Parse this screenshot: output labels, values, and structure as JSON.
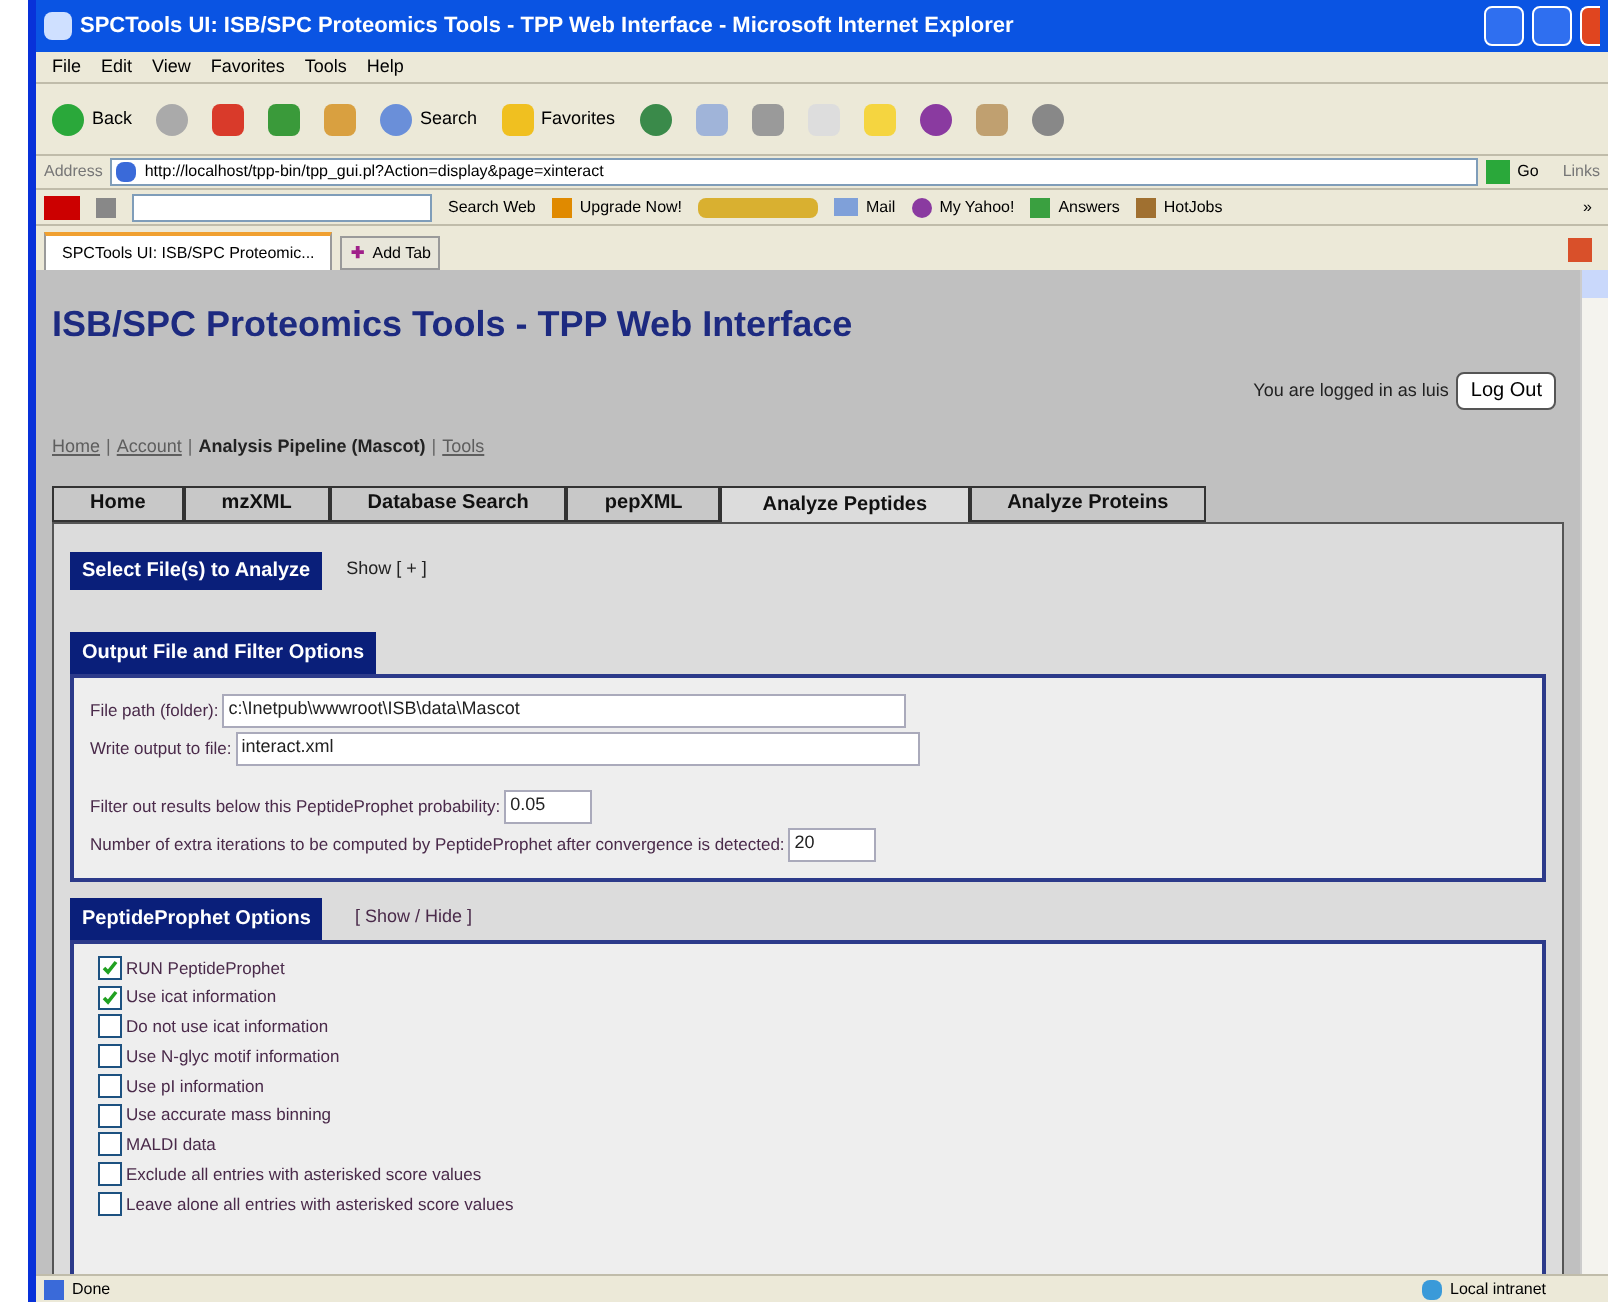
{
  "window": {
    "title": "SPCTools UI: ISB/SPC Proteomics Tools - TPP Web Interface - Microsoft Internet Explorer"
  },
  "menu": [
    "File",
    "Edit",
    "View",
    "Favorites",
    "Tools",
    "Help"
  ],
  "toolbar": {
    "back": "Back",
    "search": "Search",
    "favorites": "Favorites"
  },
  "address": {
    "label": "Address",
    "url": "http://localhost/tpp-bin/tpp_gui.pl?Action=display&page=xinteract",
    "go": "Go",
    "links": "Links"
  },
  "yahoo_bar": {
    "search": "Search Web",
    "upgrade": "Upgrade Now!",
    "mail": "Mail",
    "my_yahoo": "My Yahoo!",
    "answers": "Answers",
    "hotjobs": "HotJobs",
    "more": "»"
  },
  "browser_tabs": [
    {
      "label": "SPCTools UI: ISB/SPC Proteomic...",
      "selected": true
    }
  ],
  "add_tab": "Add Tab",
  "add_tab_glyph": "✚",
  "page": {
    "heading": "ISB/SPC Proteomics Tools - TPP Web Interface",
    "login_text": "You are logged in as luis",
    "logout": "Log Out",
    "breadcrumb_separator": "|",
    "breadcrumbs": [
      {
        "label": "Home",
        "kind": "link"
      },
      {
        "label": "Account",
        "kind": "link"
      },
      {
        "label": "Analysis Pipeline (Mascot)",
        "kind": "current"
      },
      {
        "label": "Tools",
        "kind": "link"
      }
    ],
    "tabs": [
      {
        "label": "Home",
        "selected": false
      },
      {
        "label": "mzXML",
        "selected": false
      },
      {
        "label": "Database Search",
        "selected": false
      },
      {
        "label": "pepXML",
        "selected": false
      },
      {
        "label": "Analyze Peptides",
        "selected": true
      },
      {
        "label": "Analyze Proteins",
        "selected": false
      }
    ],
    "select_files": {
      "title": "Select File(s) to Analyze",
      "toggle": "Show [ + ]"
    },
    "output_options": {
      "title": "Output File and Filter Options",
      "file_fields": [
        {
          "label": "File path (folder):",
          "value": "c:\\Inetpub\\wwwroot\\ISB\\data\\Mascot"
        },
        {
          "label": "Write output to file:",
          "value": "interact.xml"
        }
      ],
      "filter_fields": [
        {
          "label": "Filter out results below this PeptideProphet probability:",
          "value": "0.05"
        },
        {
          "label": "Number of extra iterations to be computed by PeptideProphet after convergence is detected:",
          "value": "20"
        }
      ]
    },
    "peptideprophet_options": {
      "title": "PeptideProphet Options",
      "toggle": "[ Show / Hide ]",
      "options": [
        {
          "label": "RUN PeptideProphet",
          "checked": true
        },
        {
          "label": "Use icat information",
          "checked": true
        },
        {
          "label": "Do not use icat information",
          "checked": false
        },
        {
          "label": "Use N-glyc motif information",
          "checked": false
        },
        {
          "label": "Use pI information",
          "checked": false
        },
        {
          "label": "Use accurate mass binning",
          "checked": false
        },
        {
          "label": "MALDI data",
          "checked": false
        },
        {
          "label": "Exclude all entries with asterisked score values",
          "checked": false
        },
        {
          "label": "Leave alone all entries with asterisked score values",
          "checked": false
        }
      ]
    }
  },
  "status_bar": {
    "text": "Done",
    "zone": "Local intranet"
  }
}
